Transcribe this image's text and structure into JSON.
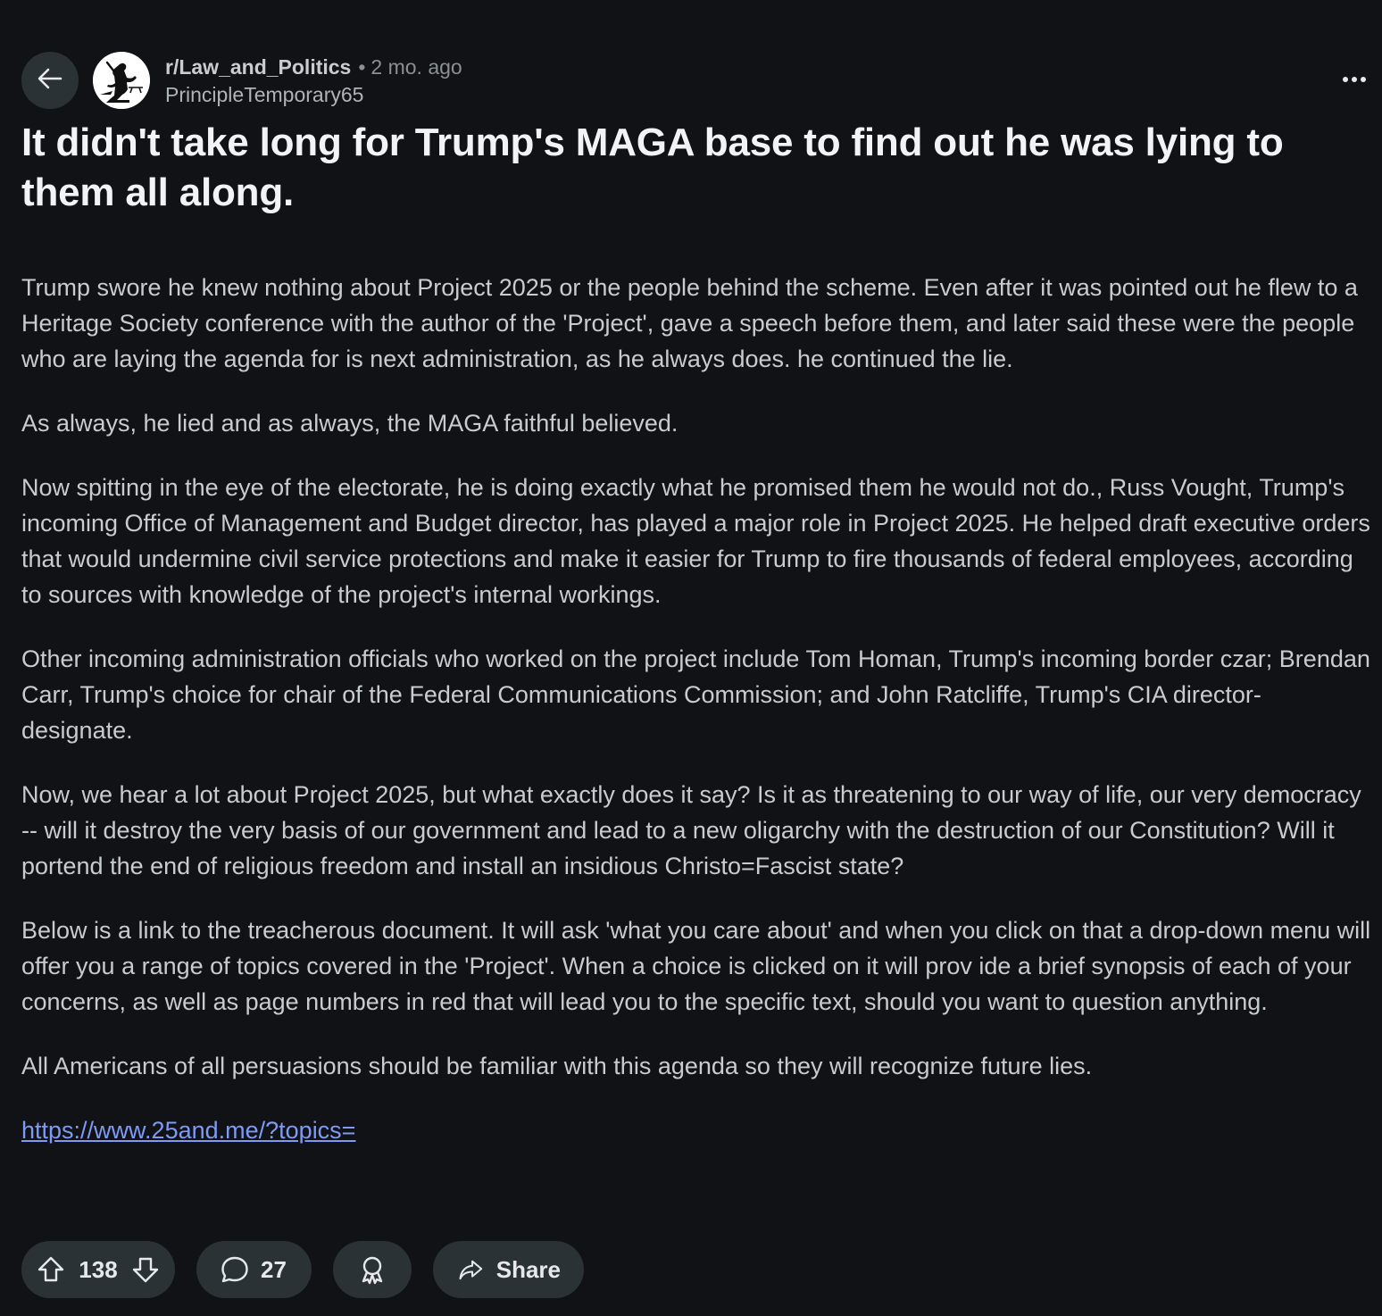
{
  "header": {
    "subreddit": "r/Law_and_Politics",
    "separator": "•",
    "time_ago": "2 mo. ago",
    "author": "PrincipleTemporary65"
  },
  "post": {
    "title": "It didn't take long for Trump's MAGA base to find out he was lying to them all along.",
    "paragraphs": [
      "Trump swore he knew nothing about Project 2025 or the people behind the scheme. Even after it was pointed out he flew to a Heritage Society conference with the author of the 'Project', gave a speech before them, and later said these were the people who are laying the agenda for is next administration, as he always does. he continued the lie.",
      "As always, he lied and as always, the MAGA faithful believed.",
      "Now spitting in the eye of the electorate, he is doing exactly what he promised them he would not do., Russ Vought, Trump's incoming Office of Management and Budget director, has played a major role in Project 2025. He helped draft executive orders that would undermine civil service protections and make it easier for Trump to fire thousands of federal employees, according to sources with knowledge of the project's internal workings.",
      "Other incoming administration officials who worked on the project include Tom Homan, Trump's incoming border czar; Brendan Carr, Trump's choice for chair of the Federal Communications Commission; and John Ratcliffe, Trump's CIA director-designate.",
      "Now, we hear a lot about Project 2025, but what exactly does it say? Is it as threatening to our way of life, our very democracy -- will it destroy the very basis of our government and lead to a new oligarchy with the destruction of our Constitution? Will it portend the end of religious freedom and install an insidious Christo=Fascist state?",
      "Below is a link to the treacherous document. It will ask 'what you care about' and when you click on that a drop-down menu will offer you a range of topics covered in the 'Project'. When a choice is clicked on it will prov ide a brief synopsis of each of your concerns, as well as page numbers in red that will lead you to the specific text, should you want to question anything.",
      "All Americans of all persuasions should be familiar with this agenda so they will recognize future lies."
    ],
    "link": "https://www.25and.me/?topics="
  },
  "actions": {
    "upvotes": "138",
    "comments": "27",
    "share_label": "Share"
  },
  "icons": {
    "back": "arrow-left-icon",
    "more": "ellipsis-icon",
    "upvote": "arrow-up-icon",
    "downvote": "arrow-down-icon",
    "comment": "speech-bubble-icon",
    "award": "award-ribbon-icon",
    "share": "share-arrow-icon"
  },
  "colors": {
    "background": "#101215",
    "pill": "#2a3236",
    "link": "#7f9af5",
    "title": "#f2f3f5",
    "body_text": "#c7ccd1"
  }
}
